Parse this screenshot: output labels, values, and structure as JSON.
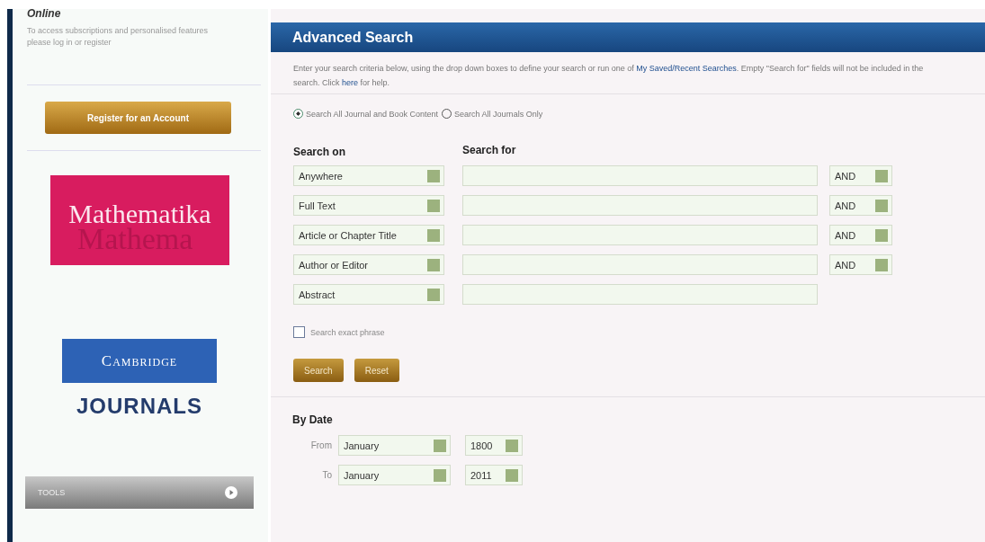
{
  "sidebar": {
    "login": {
      "title": "Online",
      "text": "To access subscriptions and personalised features please log in or register"
    },
    "register_button": "Register for an Account",
    "journal_logo": {
      "title": "Mathematika",
      "ghost": "Mathema"
    },
    "publisher_logo": {
      "top": "Cambridge",
      "bottom": "JOURNALS"
    },
    "tools": {
      "label": "TOOLS"
    }
  },
  "main": {
    "title": "Advanced Search",
    "intro": [
      {
        "kind": "text",
        "text": "Enter your search criteria below, using the drop down boxes to define your search or run one of "
      },
      {
        "kind": "link",
        "text": "My Saved/Recent Searches"
      },
      {
        "kind": "text",
        "text": ". Empty \"Search for\" fields will not be included in the search. Click "
      },
      {
        "kind": "link",
        "text": "here"
      },
      {
        "kind": "text",
        "text": " for help."
      }
    ],
    "scope": [
      {
        "label": "Search All Journal and Book Content",
        "selected": true
      },
      {
        "label": "Search All Journals Only",
        "selected": false
      }
    ],
    "columns": [
      "Search on",
      "Search for"
    ],
    "rows": [
      {
        "field": "Anywhere",
        "operator": "AND"
      },
      {
        "field": "Full Text",
        "operator": "AND"
      },
      {
        "field": "Article or Chapter Title",
        "operator": "AND"
      },
      {
        "field": "Author or Editor",
        "operator": "AND"
      },
      {
        "field": "Abstract"
      }
    ],
    "exact_phrase": {
      "label": "Search exact phrase",
      "checked": false
    },
    "buttons": [
      "Search",
      "Reset"
    ],
    "by_date": {
      "title": "By Date",
      "rows": [
        {
          "label": "From",
          "month": "January",
          "year": "1800"
        },
        {
          "label": "To",
          "month": "January",
          "year": "2011"
        }
      ]
    }
  }
}
